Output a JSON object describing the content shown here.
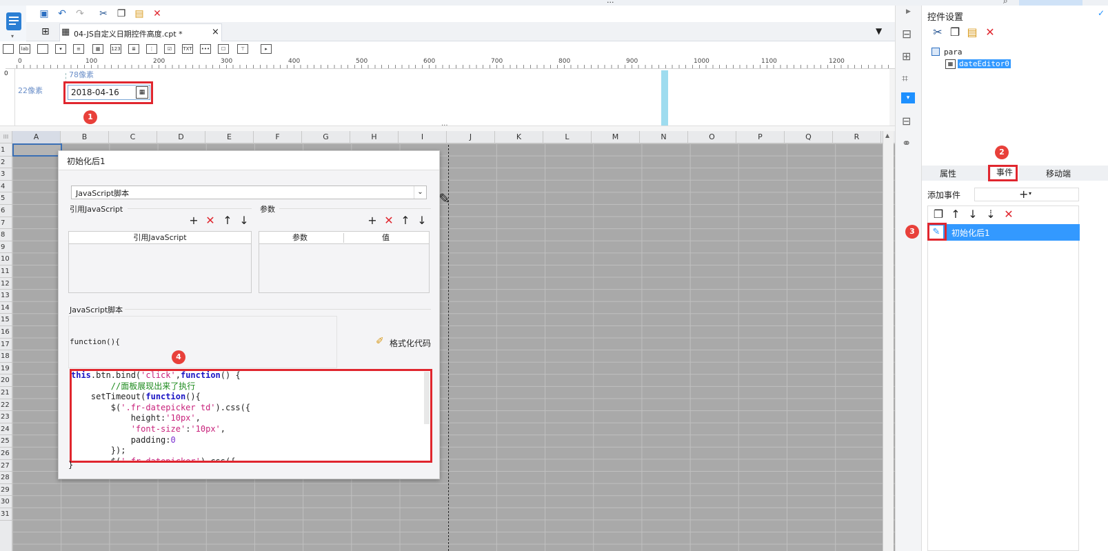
{
  "window": {
    "title": "..."
  },
  "tabs": [
    {
      "label": "04-JS自定义日期控件高度.cpt *",
      "close": "×"
    }
  ],
  "widget_toolbar": {
    "items": [
      "lab",
      "123",
      "TXT"
    ]
  },
  "ruler": {
    "labels": [
      "0",
      "100",
      "200",
      "300",
      "400",
      "500",
      "600",
      "700",
      "800",
      "900",
      "1000",
      "1100",
      "1200"
    ]
  },
  "param_area": {
    "top_label": "78像素",
    "left_label": "22像素",
    "date_value": "2018-04-16",
    "badge1": "1",
    "left_ruler": "0"
  },
  "grid": {
    "columns": [
      "A",
      "B",
      "C",
      "D",
      "E",
      "F",
      "G",
      "H",
      "I",
      "J",
      "K",
      "L",
      "M",
      "N",
      "O",
      "P",
      "Q",
      "R"
    ],
    "rows": [
      "1",
      "2",
      "3",
      "4",
      "5",
      "6",
      "7",
      "8",
      "9",
      "10",
      "11",
      "12",
      "13",
      "14",
      "15",
      "16",
      "17",
      "18",
      "19",
      "20",
      "21",
      "22",
      "23",
      "24",
      "25",
      "26",
      "27",
      "28",
      "29",
      "30",
      "31"
    ]
  },
  "dialog": {
    "title": "初始化后1",
    "type_select": "JavaScript脚本",
    "ref_section": "引用JavaScript",
    "param_section": "参数",
    "ref_table_header": "引用JavaScript",
    "param_table_headers": [
      "参数",
      "值"
    ],
    "script_section": "JavaScript脚本",
    "function_head": "function(){",
    "function_tail": "}",
    "format_button": "格式化代码",
    "badge4": "4"
  },
  "right_panel": {
    "title": "控件设置",
    "tree_root": "para",
    "tree_child": "dateEditor0",
    "tabs": [
      "属性",
      "事件",
      "移动端"
    ],
    "badge2": "2",
    "badge3": "3",
    "add_event_label": "添加事件",
    "event_item": "初始化后1"
  },
  "colors": {
    "accent_blue": "#1e90ff",
    "highlight_red": "#e0262e",
    "grid_gray": "#a9a9a9",
    "selected_blue": "#3399ff"
  }
}
